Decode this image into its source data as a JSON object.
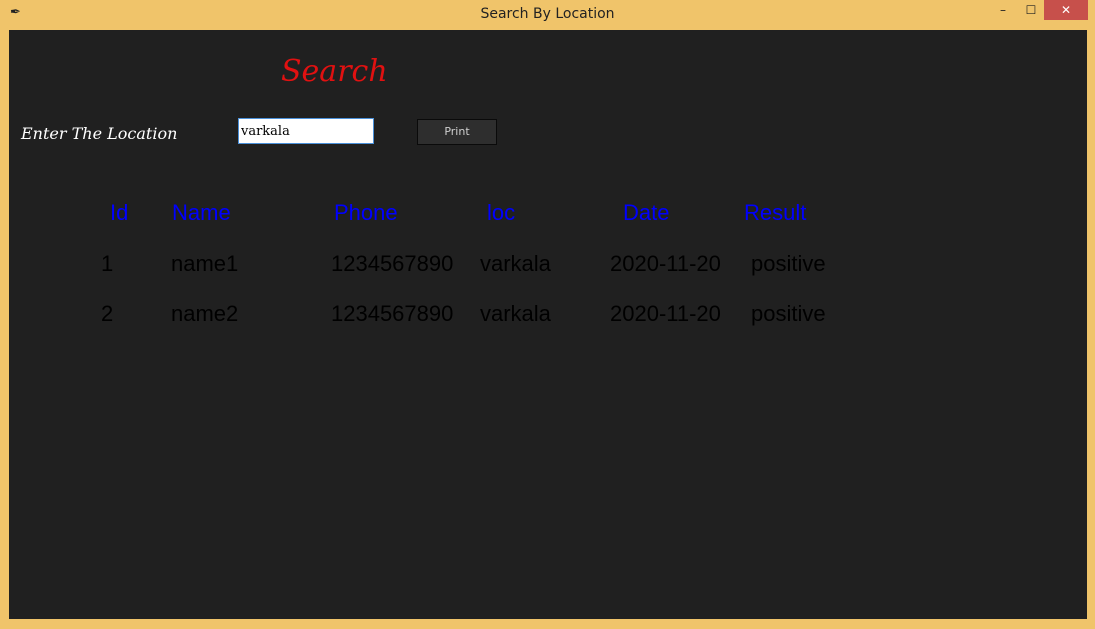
{
  "window": {
    "title": "Search By Location",
    "icon": "feather-icon",
    "minimize_glyph": "–",
    "maximize_glyph": "☐",
    "close_glyph": "✕"
  },
  "form": {
    "heading": "Search",
    "location_label": "Enter The Location",
    "location_value": "varkala",
    "print_label": "Print"
  },
  "table": {
    "headers": [
      "Id",
      "Name",
      "Phone",
      "loc",
      "Date",
      "Result"
    ],
    "rows": [
      [
        "1",
        "name1",
        "1234567890",
        "varkala",
        "2020-11-20",
        "positive"
      ],
      [
        "2",
        "name2",
        "1234567890",
        "varkala",
        "2020-11-20",
        "positive"
      ]
    ]
  },
  "colors": {
    "window_frame": "#f0c46a",
    "background": "#202020",
    "heading": "#e11111",
    "header_text": "#0000ff",
    "close_button": "#c7504b"
  }
}
